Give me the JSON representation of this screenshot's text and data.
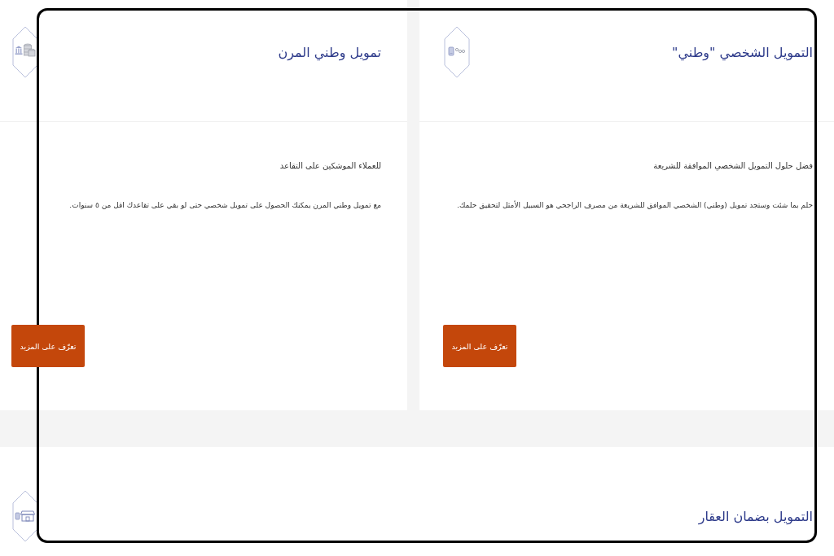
{
  "cards": [
    {
      "title": "التمويل الشخصي \"وطني\"",
      "subtitle": "فضل حلول التمويل الشخصي الموافقة للشريعة",
      "description": "حلم بما شئت وستجد تمويل (وطني) الشخصي الموافق للشريعة من مصرف الراجحي هو السبيل الأمثل لتحقيق حلمك.",
      "button": "تعرّف على المزيد"
    },
    {
      "title": "تمويل وطني المرن",
      "subtitle": "للعملاء الموشكين على التقاعد",
      "description": "مع تمويل وطني المرن يمكنك الحصول على تمويل شخصي حتى لو بقي على تقاعدك اقل من ٥ سنوات.",
      "button": "تعرّف على المزيد"
    },
    {
      "title": "التمويل بضمان العقار"
    }
  ]
}
